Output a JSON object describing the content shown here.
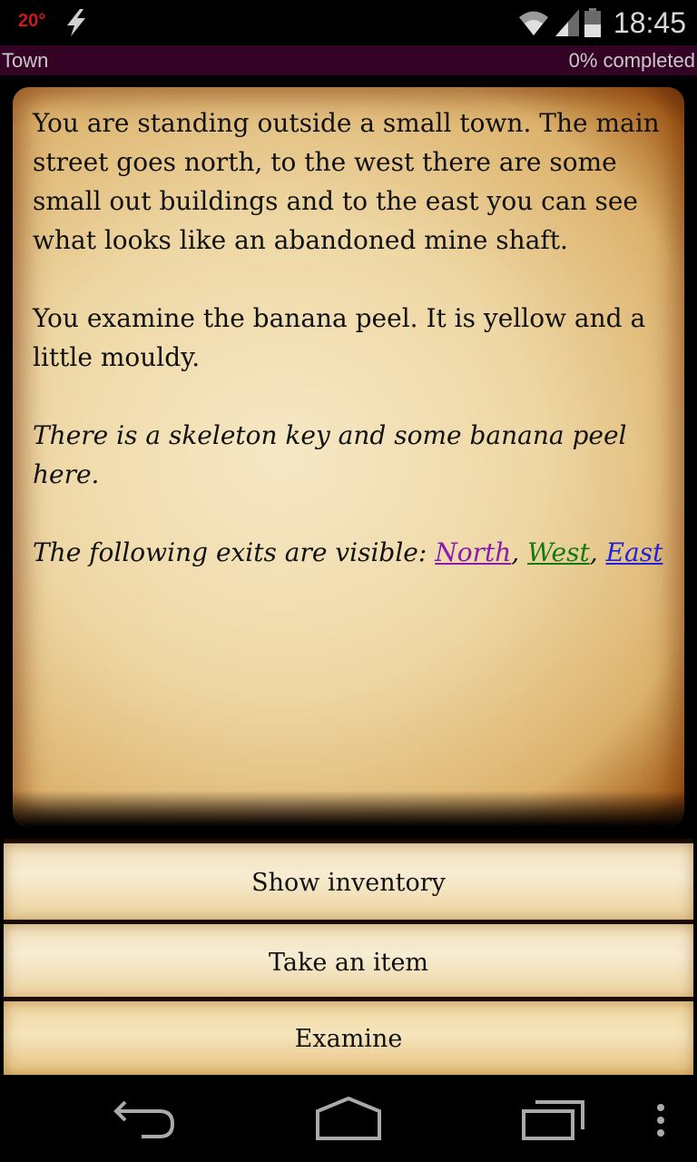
{
  "status_bar": {
    "temperature": "20°",
    "time": "18:45",
    "icons": [
      "lightning-icon",
      "wifi-icon",
      "signal-icon",
      "battery-icon"
    ]
  },
  "title_bar": {
    "location": "Town",
    "progress_text": "0% completed",
    "progress_percent": 0,
    "background_color": "#340224"
  },
  "story": {
    "paragraph_1": "You are standing outside a small town. The main street goes north, to the west there are some small out buildings and to the east you can see what looks like an abandoned mine shaft.",
    "paragraph_2": "You examine the banana peel. It is yellow and a little mouldy.",
    "paragraph_3": "There is a skeleton key and some banana peel here.",
    "exits_prefix": "The following exits are visible: ",
    "exits": [
      {
        "label": "North",
        "color": "#8a1ab0"
      },
      {
        "label": "West",
        "color": "#137a13"
      },
      {
        "label": "East",
        "color": "#2222dd"
      }
    ],
    "separator": ", "
  },
  "actions": [
    {
      "label": "Show inventory"
    },
    {
      "label": "Take an item"
    },
    {
      "label": "Examine"
    }
  ],
  "nav_bar": {
    "buttons": [
      "back-icon",
      "home-icon",
      "recent-apps-icon",
      "overflow-menu-icon"
    ]
  }
}
